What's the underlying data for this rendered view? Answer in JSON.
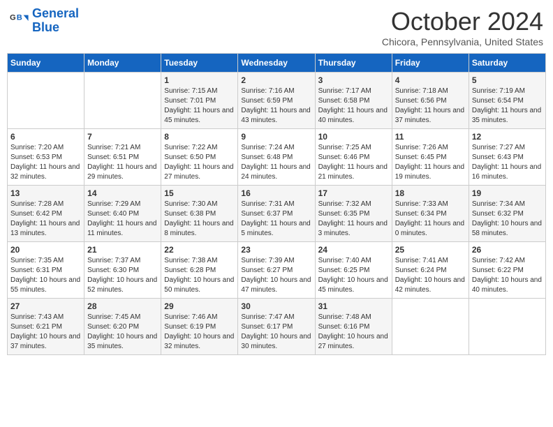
{
  "header": {
    "logo_line1": "General",
    "logo_line2": "Blue",
    "month": "October 2024",
    "location": "Chicora, Pennsylvania, United States"
  },
  "days_of_week": [
    "Sunday",
    "Monday",
    "Tuesday",
    "Wednesday",
    "Thursday",
    "Friday",
    "Saturday"
  ],
  "weeks": [
    [
      {
        "day": "",
        "info": ""
      },
      {
        "day": "",
        "info": ""
      },
      {
        "day": "1",
        "info": "Sunrise: 7:15 AM\nSunset: 7:01 PM\nDaylight: 11 hours and 45 minutes."
      },
      {
        "day": "2",
        "info": "Sunrise: 7:16 AM\nSunset: 6:59 PM\nDaylight: 11 hours and 43 minutes."
      },
      {
        "day": "3",
        "info": "Sunrise: 7:17 AM\nSunset: 6:58 PM\nDaylight: 11 hours and 40 minutes."
      },
      {
        "day": "4",
        "info": "Sunrise: 7:18 AM\nSunset: 6:56 PM\nDaylight: 11 hours and 37 minutes."
      },
      {
        "day": "5",
        "info": "Sunrise: 7:19 AM\nSunset: 6:54 PM\nDaylight: 11 hours and 35 minutes."
      }
    ],
    [
      {
        "day": "6",
        "info": "Sunrise: 7:20 AM\nSunset: 6:53 PM\nDaylight: 11 hours and 32 minutes."
      },
      {
        "day": "7",
        "info": "Sunrise: 7:21 AM\nSunset: 6:51 PM\nDaylight: 11 hours and 29 minutes."
      },
      {
        "day": "8",
        "info": "Sunrise: 7:22 AM\nSunset: 6:50 PM\nDaylight: 11 hours and 27 minutes."
      },
      {
        "day": "9",
        "info": "Sunrise: 7:24 AM\nSunset: 6:48 PM\nDaylight: 11 hours and 24 minutes."
      },
      {
        "day": "10",
        "info": "Sunrise: 7:25 AM\nSunset: 6:46 PM\nDaylight: 11 hours and 21 minutes."
      },
      {
        "day": "11",
        "info": "Sunrise: 7:26 AM\nSunset: 6:45 PM\nDaylight: 11 hours and 19 minutes."
      },
      {
        "day": "12",
        "info": "Sunrise: 7:27 AM\nSunset: 6:43 PM\nDaylight: 11 hours and 16 minutes."
      }
    ],
    [
      {
        "day": "13",
        "info": "Sunrise: 7:28 AM\nSunset: 6:42 PM\nDaylight: 11 hours and 13 minutes."
      },
      {
        "day": "14",
        "info": "Sunrise: 7:29 AM\nSunset: 6:40 PM\nDaylight: 11 hours and 11 minutes."
      },
      {
        "day": "15",
        "info": "Sunrise: 7:30 AM\nSunset: 6:38 PM\nDaylight: 11 hours and 8 minutes."
      },
      {
        "day": "16",
        "info": "Sunrise: 7:31 AM\nSunset: 6:37 PM\nDaylight: 11 hours and 5 minutes."
      },
      {
        "day": "17",
        "info": "Sunrise: 7:32 AM\nSunset: 6:35 PM\nDaylight: 11 hours and 3 minutes."
      },
      {
        "day": "18",
        "info": "Sunrise: 7:33 AM\nSunset: 6:34 PM\nDaylight: 11 hours and 0 minutes."
      },
      {
        "day": "19",
        "info": "Sunrise: 7:34 AM\nSunset: 6:32 PM\nDaylight: 10 hours and 58 minutes."
      }
    ],
    [
      {
        "day": "20",
        "info": "Sunrise: 7:35 AM\nSunset: 6:31 PM\nDaylight: 10 hours and 55 minutes."
      },
      {
        "day": "21",
        "info": "Sunrise: 7:37 AM\nSunset: 6:30 PM\nDaylight: 10 hours and 52 minutes."
      },
      {
        "day": "22",
        "info": "Sunrise: 7:38 AM\nSunset: 6:28 PM\nDaylight: 10 hours and 50 minutes."
      },
      {
        "day": "23",
        "info": "Sunrise: 7:39 AM\nSunset: 6:27 PM\nDaylight: 10 hours and 47 minutes."
      },
      {
        "day": "24",
        "info": "Sunrise: 7:40 AM\nSunset: 6:25 PM\nDaylight: 10 hours and 45 minutes."
      },
      {
        "day": "25",
        "info": "Sunrise: 7:41 AM\nSunset: 6:24 PM\nDaylight: 10 hours and 42 minutes."
      },
      {
        "day": "26",
        "info": "Sunrise: 7:42 AM\nSunset: 6:22 PM\nDaylight: 10 hours and 40 minutes."
      }
    ],
    [
      {
        "day": "27",
        "info": "Sunrise: 7:43 AM\nSunset: 6:21 PM\nDaylight: 10 hours and 37 minutes."
      },
      {
        "day": "28",
        "info": "Sunrise: 7:45 AM\nSunset: 6:20 PM\nDaylight: 10 hours and 35 minutes."
      },
      {
        "day": "29",
        "info": "Sunrise: 7:46 AM\nSunset: 6:19 PM\nDaylight: 10 hours and 32 minutes."
      },
      {
        "day": "30",
        "info": "Sunrise: 7:47 AM\nSunset: 6:17 PM\nDaylight: 10 hours and 30 minutes."
      },
      {
        "day": "31",
        "info": "Sunrise: 7:48 AM\nSunset: 6:16 PM\nDaylight: 10 hours and 27 minutes."
      },
      {
        "day": "",
        "info": ""
      },
      {
        "day": "",
        "info": ""
      }
    ]
  ]
}
